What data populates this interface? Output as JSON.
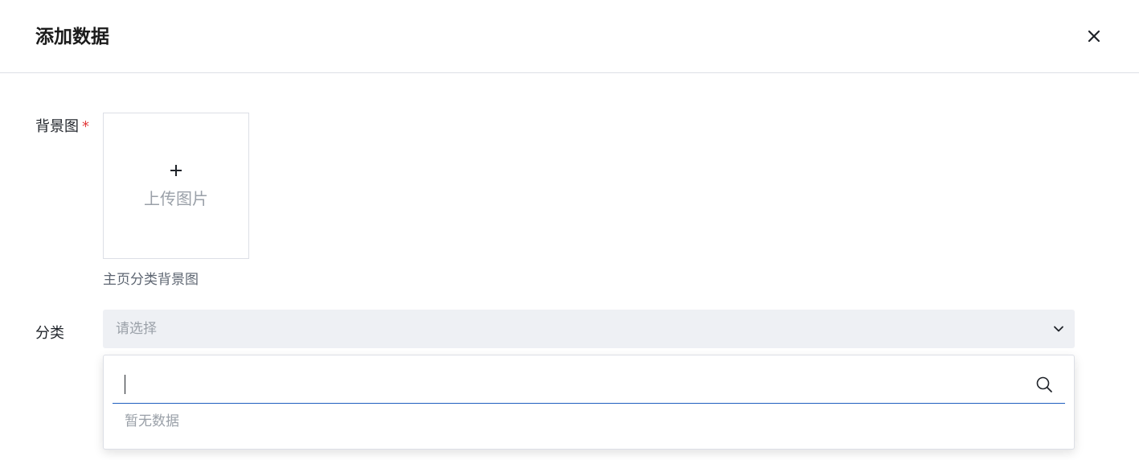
{
  "dialog": {
    "title": "添加数据",
    "close_icon": "close-icon"
  },
  "form": {
    "background": {
      "label": "背景图",
      "required_mark": "*",
      "upload_icon": "plus-icon",
      "upload_text": "上传图片",
      "hint": "主页分类背景图"
    },
    "category": {
      "label": "分类",
      "placeholder": "请选择",
      "chevron_icon": "chevron-down-icon",
      "dropdown": {
        "search_value": "",
        "search_icon": "search-icon",
        "empty_text": "暂无数据"
      }
    }
  },
  "colors": {
    "required": "#e23b3b",
    "focus_border": "#1f5fbf",
    "select_bg": "#eef0f4"
  }
}
